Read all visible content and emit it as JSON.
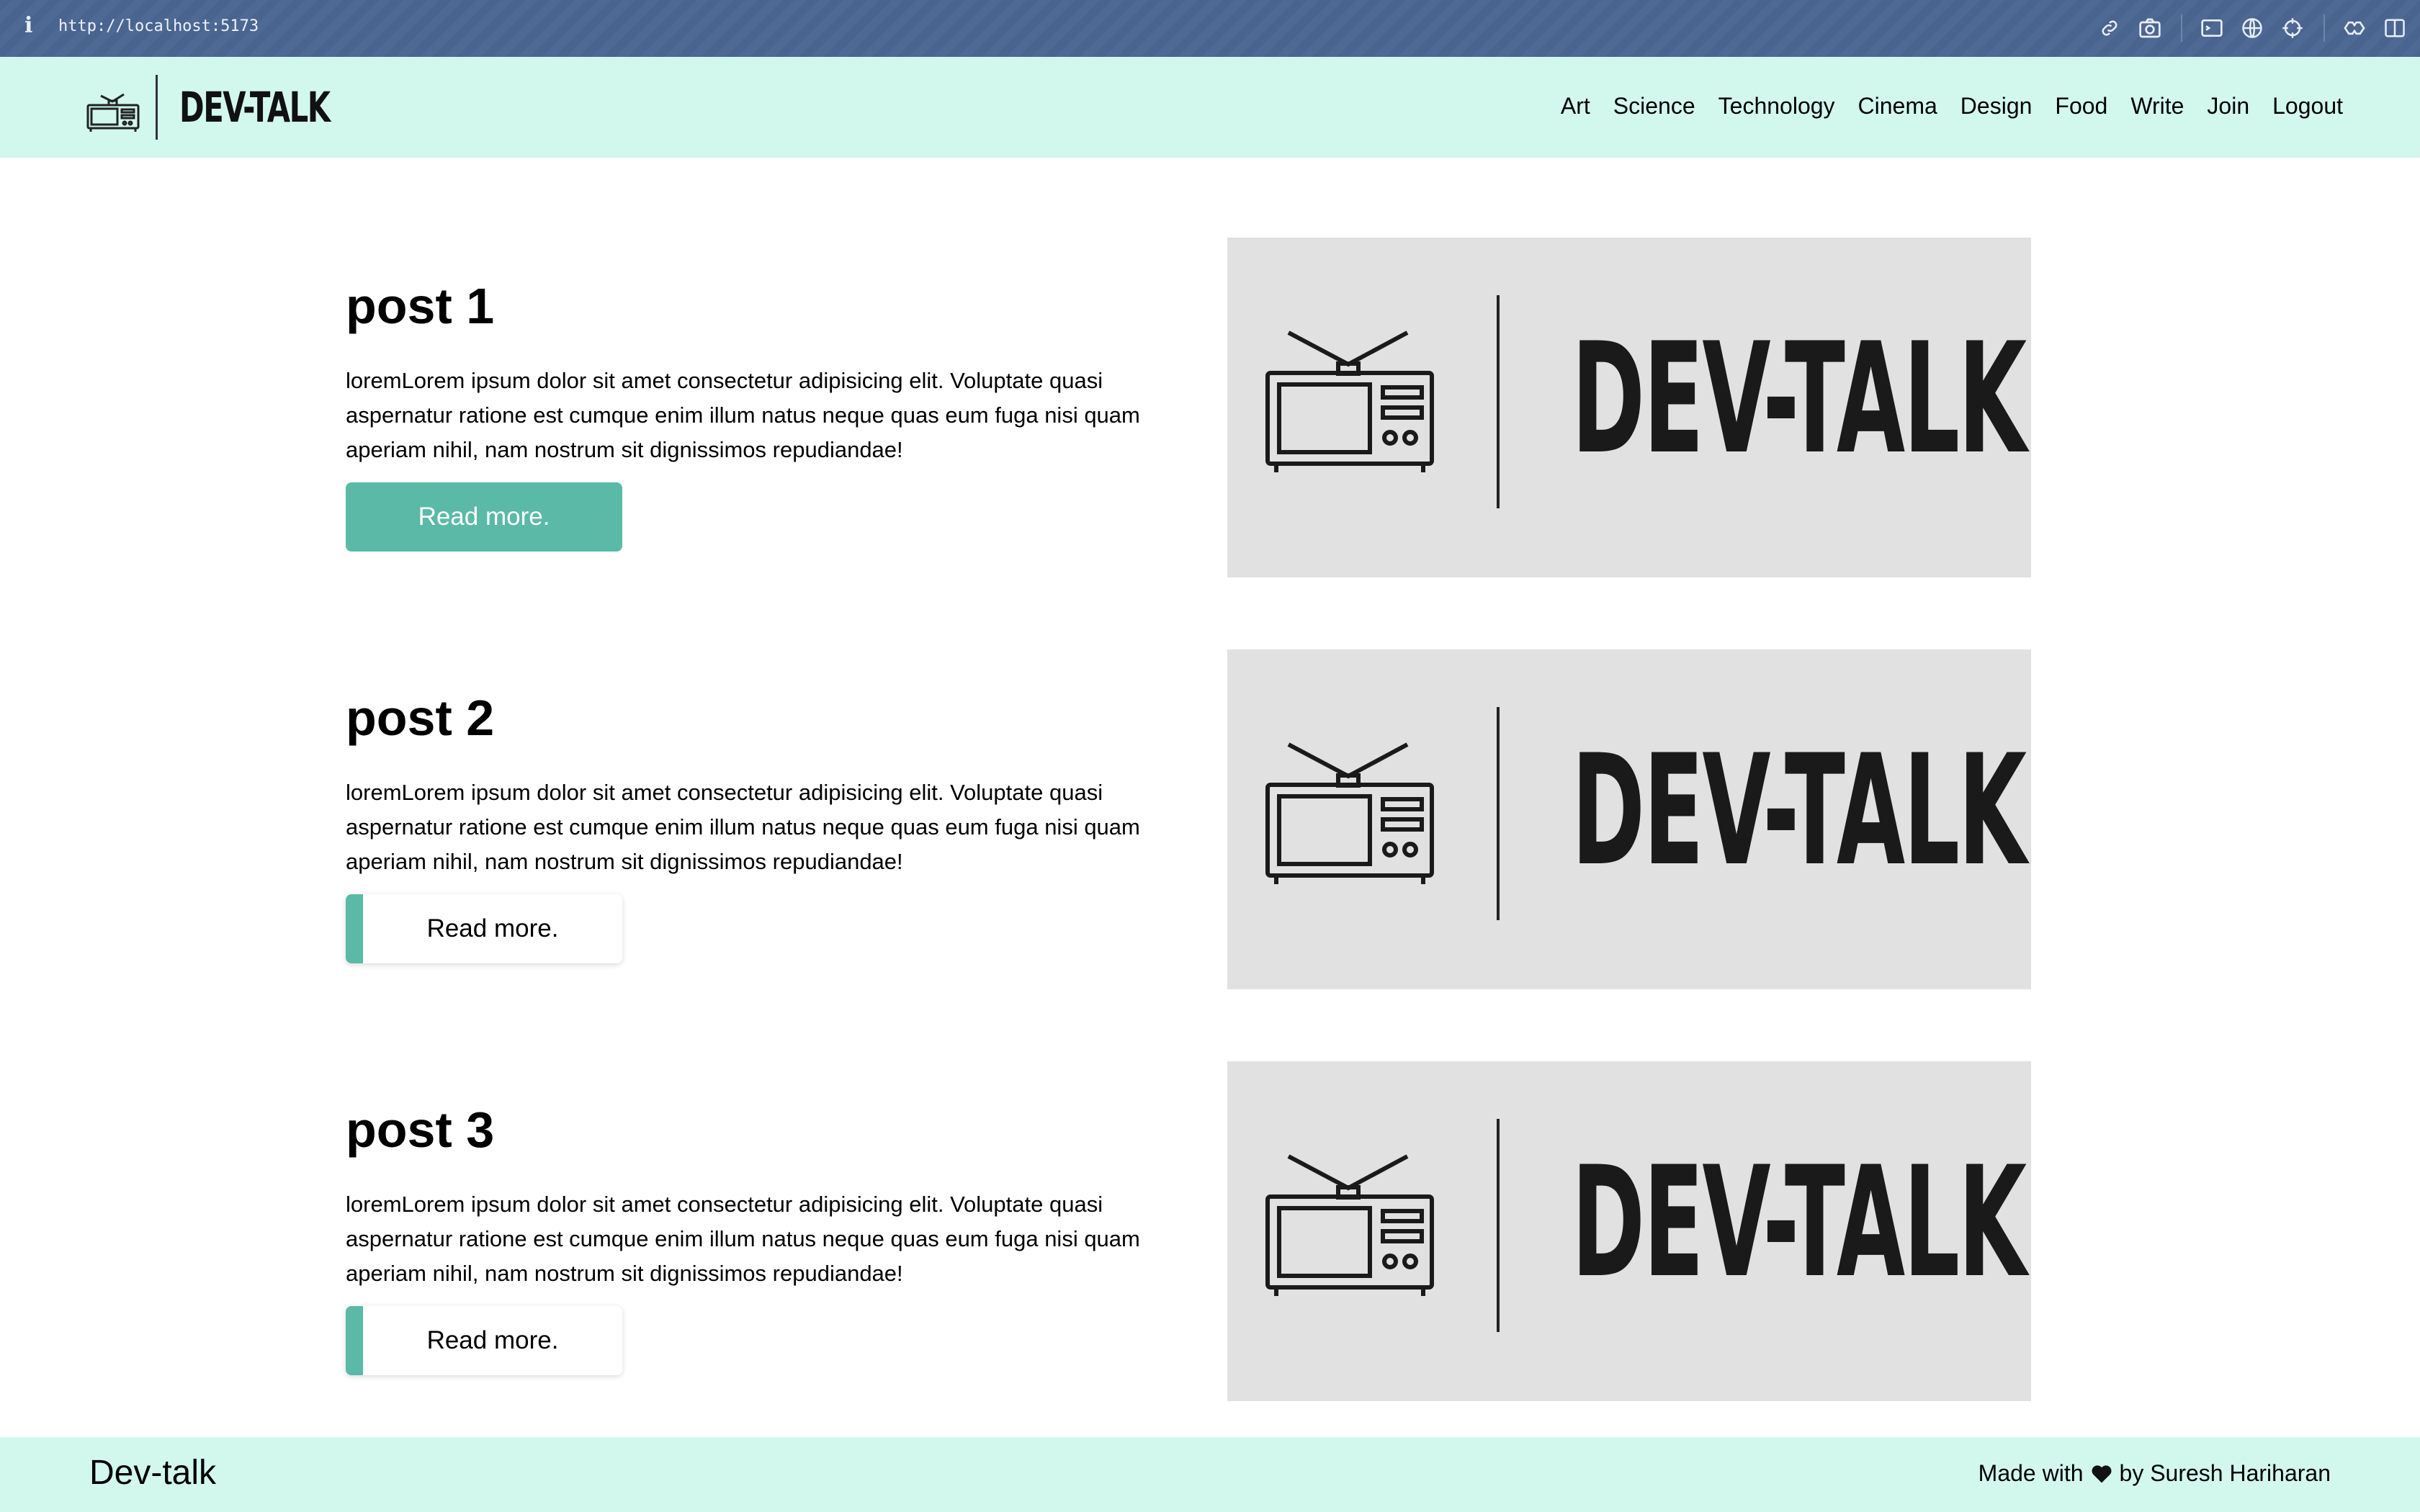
{
  "browser": {
    "info_icon": "i",
    "url": "http://localhost:5173",
    "tools": [
      "link-icon",
      "camera-icon",
      "terminal-icon",
      "globe-icon",
      "crosshair-icon",
      "extensions-icon",
      "sidebar-icon"
    ]
  },
  "header": {
    "logo_text": "DEV-TALK",
    "nav": [
      "Art",
      "Science",
      "Technology",
      "Cinema",
      "Design",
      "Food",
      "Write",
      "Join",
      "Logout"
    ]
  },
  "posts": [
    {
      "title": "post 1",
      "body": "loremLorem ipsum dolor sit amet consectetur adipisicing elit. Voluptate quasi aspernatur ratione est cumque enim illum natus neque quas eum fuga nisi quam aperiam nihil, nam nostrum sit dignissimos repudiandae!",
      "button": "Read more.",
      "button_state": "hovered",
      "image_text": "DEV-TALK"
    },
    {
      "title": "post 2",
      "body": "loremLorem ipsum dolor sit amet consectetur adipisicing elit. Voluptate quasi aspernatur ratione est cumque enim illum natus neque quas eum fuga nisi quam aperiam nihil, nam nostrum sit dignissimos repudiandae!",
      "button": "Read more.",
      "button_state": "default",
      "image_text": "DEV-TALK"
    },
    {
      "title": "post 3",
      "body": "loremLorem ipsum dolor sit amet consectetur adipisicing elit. Voluptate quasi aspernatur ratione est cumque enim illum natus neque quas eum fuga nisi quam aperiam nihil, nam nostrum sit dignissimos repudiandae!",
      "button": "Read more.",
      "button_state": "default",
      "image_text": "DEV-TALK"
    }
  ],
  "footer": {
    "brand": "Dev-talk",
    "credit_prefix": "Made with",
    "credit_suffix": "by Suresh Hariharan"
  },
  "colors": {
    "accent": "#5bb9a8",
    "header_bg": "#d2f8ee",
    "image_bg": "#e1e1e1",
    "browser_bar": "#4a6490"
  }
}
